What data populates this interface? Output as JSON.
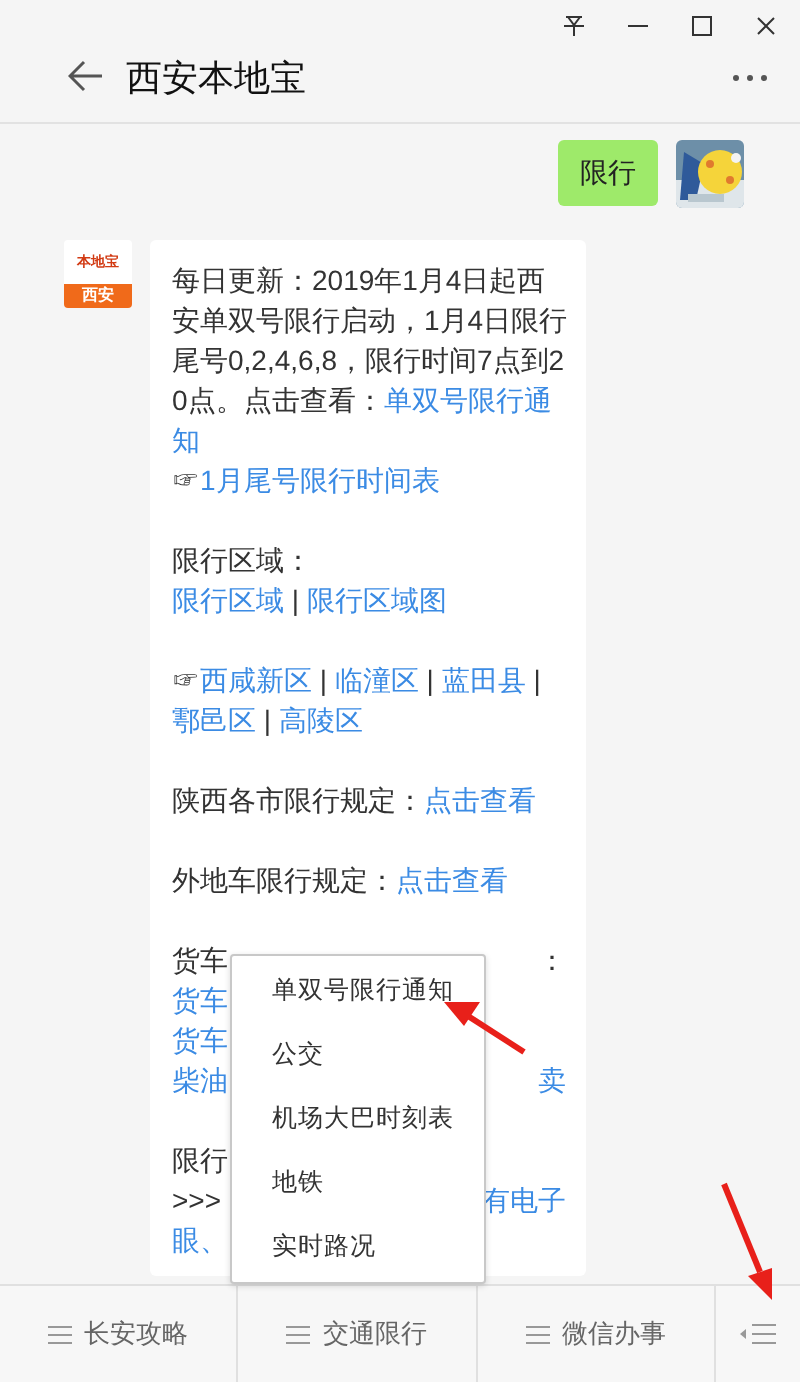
{
  "window": {
    "title": "西安本地宝"
  },
  "messages": [
    {
      "kind": "outgoing",
      "text": "限行"
    },
    {
      "kind": "incoming",
      "logo": {
        "brand": "本地宝",
        "city": "西安"
      },
      "paragraphs": [
        {
          "lines": [
            {
              "left": [
                {
                  "text": "每日更新：2019年1月4日起西",
                  "kind": "text"
                }
              ]
            },
            {
              "left": [
                {
                  "text": "安单双号限行启动，1月4日限行",
                  "kind": "text"
                }
              ]
            },
            {
              "left": [
                {
                  "text": "尾号0,2,4,6,8，限行时间7点到2",
                  "kind": "text"
                }
              ]
            },
            {
              "left": [
                {
                  "text": "0点。点击查看：",
                  "kind": "text"
                },
                {
                  "text": "单双号限行通",
                  "kind": "link"
                }
              ]
            },
            {
              "left": [
                {
                  "text": "知",
                  "kind": "link"
                }
              ]
            },
            {
              "left": [
                {
                  "text": "☞",
                  "kind": "text"
                },
                {
                  "text": "1月尾号限行时间表",
                  "kind": "link"
                }
              ]
            }
          ]
        },
        {
          "lines": [
            {
              "left": [
                {
                  "text": "限行区域：",
                  "kind": "text"
                }
              ]
            },
            {
              "left": [
                {
                  "text": "限行区域",
                  "kind": "link"
                },
                {
                  "text": " | ",
                  "kind": "text"
                },
                {
                  "text": "限行区域图",
                  "kind": "link"
                }
              ]
            }
          ]
        },
        {
          "lines": [
            {
              "left": [
                {
                  "text": "☞",
                  "kind": "text"
                },
                {
                  "text": "西咸新区",
                  "kind": "link"
                },
                {
                  "text": " | ",
                  "kind": "text"
                },
                {
                  "text": "临潼区",
                  "kind": "link"
                },
                {
                  "text": " | ",
                  "kind": "text"
                },
                {
                  "text": "蓝田县",
                  "kind": "link"
                },
                {
                  "text": " |",
                  "kind": "text"
                }
              ]
            },
            {
              "left": [
                {
                  "text": "鄠邑区",
                  "kind": "link"
                },
                {
                  "text": " | ",
                  "kind": "text"
                },
                {
                  "text": "高陵区",
                  "kind": "link"
                }
              ]
            }
          ]
        },
        {
          "lines": [
            {
              "left": [
                {
                  "text": "陕西各市限行规定：",
                  "kind": "text"
                },
                {
                  "text": "点击查看",
                  "kind": "link"
                }
              ]
            }
          ]
        },
        {
          "lines": [
            {
              "left": [
                {
                  "text": "外地车限行规定：",
                  "kind": "text"
                },
                {
                  "text": "点击查看",
                  "kind": "link"
                }
              ]
            }
          ]
        },
        {
          "lines": [
            {
              "left": [
                {
                  "text": "货车",
                  "kind": "text"
                }
              ],
              "right": [
                {
                  "text": "：",
                  "kind": "text"
                }
              ]
            },
            {
              "left": [
                {
                  "text": "货车",
                  "kind": "link"
                }
              ]
            },
            {
              "left": [
                {
                  "text": "货车",
                  "kind": "link"
                }
              ]
            },
            {
              "left": [
                {
                  "text": "柴油",
                  "kind": "link"
                }
              ],
              "right": [
                {
                  "text": "卖",
                  "kind": "link"
                }
              ]
            }
          ]
        },
        {
          "lines": [
            {
              "left": [
                {
                  "text": "限行",
                  "kind": "text"
                }
              ]
            },
            {
              "left": [
                {
                  "text": ">>>",
                  "kind": "text"
                }
              ],
              "right": [
                {
                  "text": "有电子",
                  "kind": "link"
                }
              ]
            },
            {
              "left": [
                {
                  "text": "眼、",
                  "kind": "link"
                }
              ]
            }
          ]
        }
      ]
    }
  ],
  "popup_menu": {
    "items": [
      "单双号限行通知",
      "公交",
      "机场大巴时刻表",
      "地铁",
      "实时路况"
    ]
  },
  "bottom_menu": {
    "items": [
      {
        "kind": "menu",
        "label": "长安攻略"
      },
      {
        "kind": "menu",
        "label": "交通限行"
      },
      {
        "kind": "menu",
        "label": "微信办事"
      },
      {
        "kind": "keyboard"
      }
    ]
  }
}
